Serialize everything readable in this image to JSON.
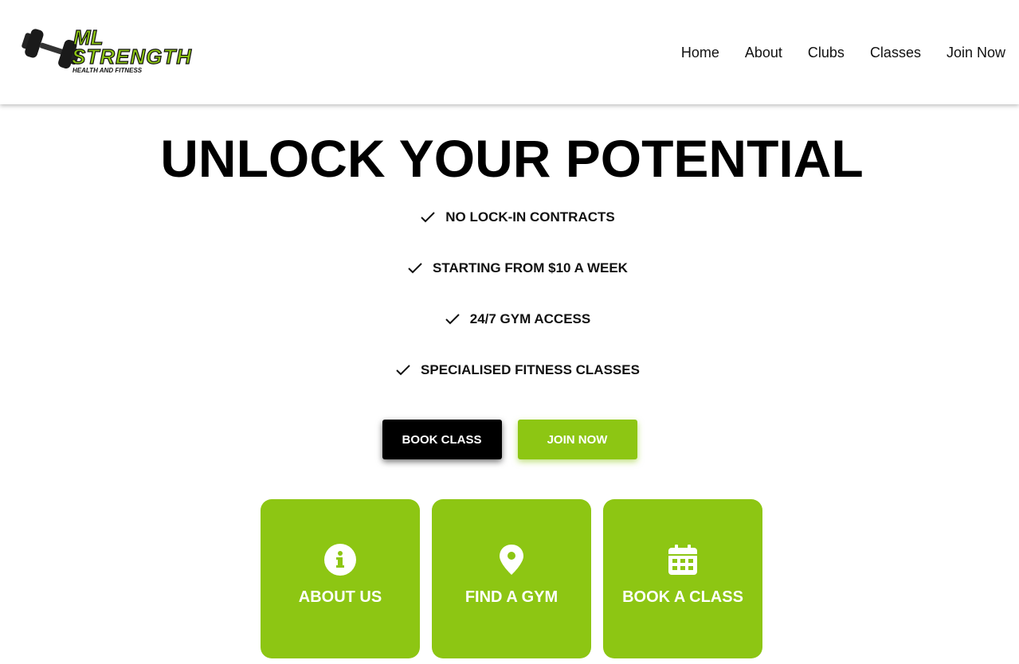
{
  "brand": {
    "name_line1": "ML",
    "name_line2": "STRENGTH",
    "tagline": "HEALTH AND FITNESS",
    "accent_color": "#8dc613"
  },
  "nav": {
    "items": [
      {
        "label": "Home"
      },
      {
        "label": "About"
      },
      {
        "label": "Clubs"
      },
      {
        "label": "Classes"
      },
      {
        "label": "Join Now"
      }
    ]
  },
  "hero": {
    "title": "UNLOCK YOUR POTENTIAL",
    "features": [
      {
        "icon": "check-icon",
        "text": "NO LOCK-IN CONTRACTS"
      },
      {
        "icon": "check-icon",
        "text": "STARTING FROM $10 A WEEK"
      },
      {
        "icon": "check-icon",
        "text": "24/7 GYM ACCESS"
      },
      {
        "icon": "check-icon",
        "text": "SPECIALISED FITNESS CLASSES"
      }
    ],
    "buttons": {
      "book_class": "BOOK CLASS",
      "join_now": "JOIN NOW"
    }
  },
  "cards": [
    {
      "icon": "info-circle-icon",
      "label": "ABOUT US"
    },
    {
      "icon": "map-pin-icon",
      "label": "FIND A GYM"
    },
    {
      "icon": "calendar-icon",
      "label": "BOOK A CLASS"
    }
  ]
}
